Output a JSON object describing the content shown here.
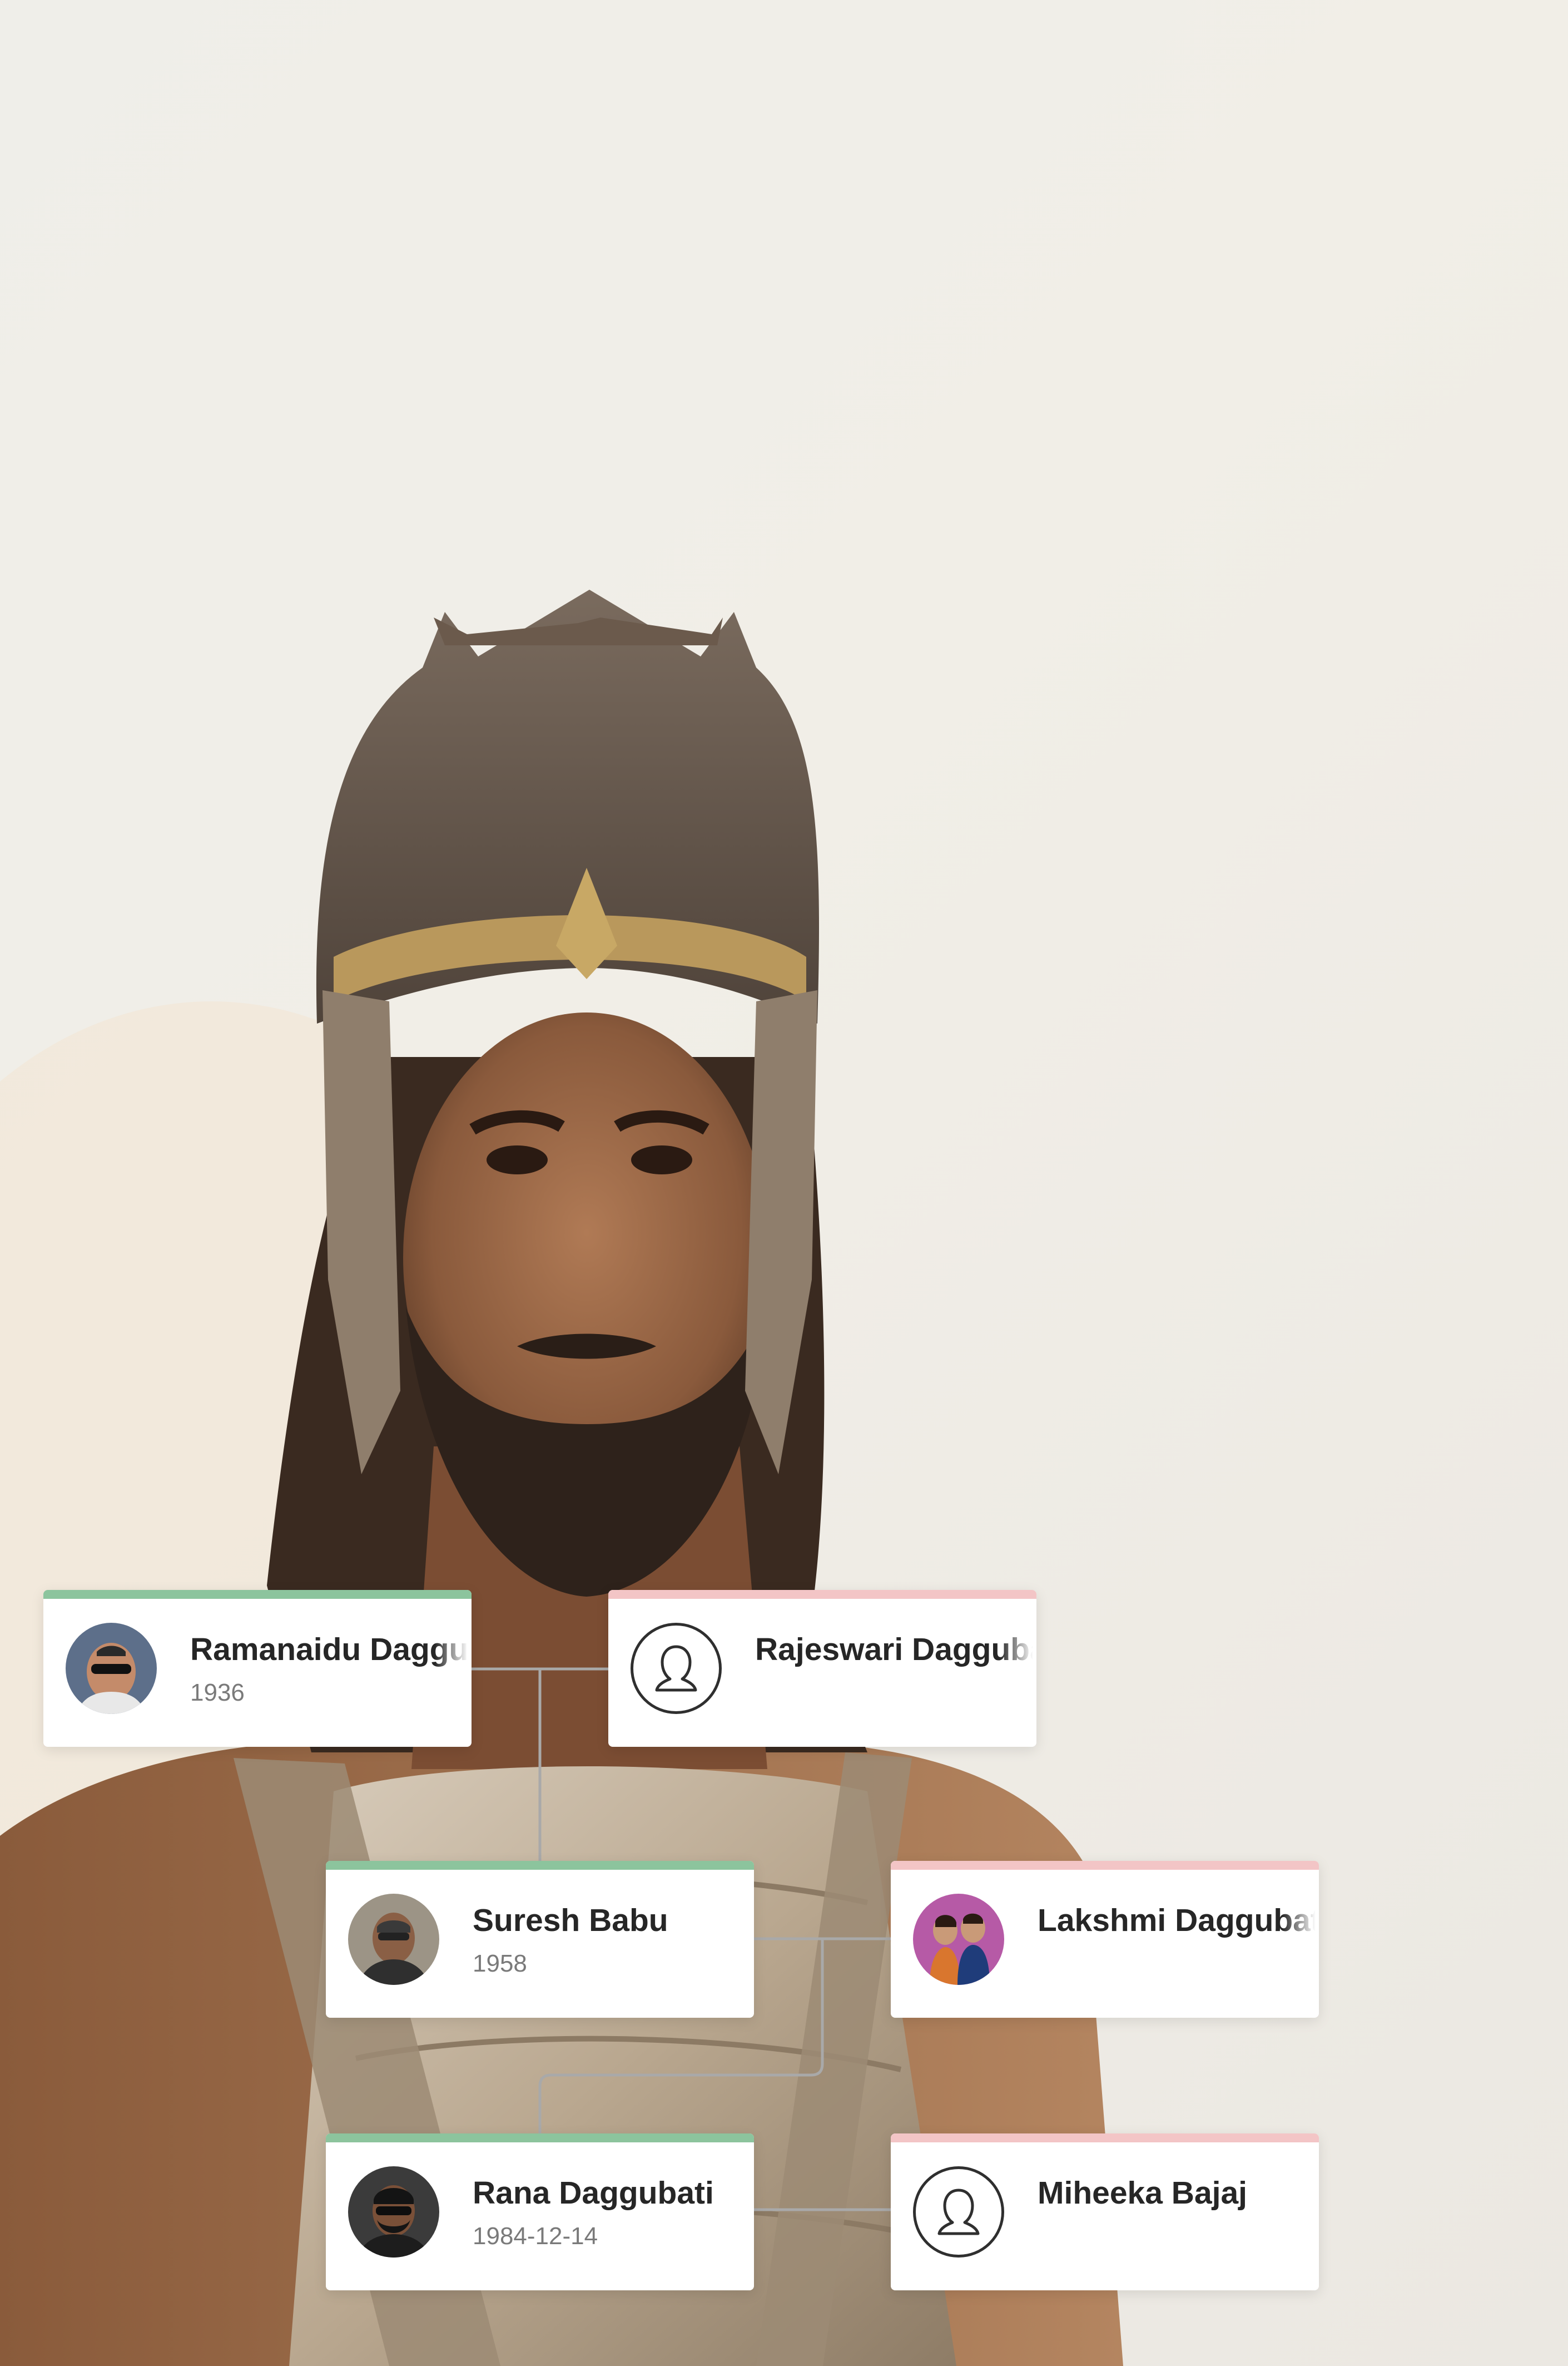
{
  "colors": {
    "male_bar": "#8cc49d",
    "female_bar": "#f3c5c6",
    "connector": "#a9a9a9",
    "card_bg": "#ffffff"
  },
  "people": [
    {
      "id": "ramanaidu",
      "name": "Ramanaidu Daggubati",
      "year": "1936",
      "gender": "male",
      "avatar": "photo"
    },
    {
      "id": "rajeswari",
      "name": "Rajeswari Daggubati",
      "year": "",
      "gender": "female",
      "avatar": "placeholder-icon"
    },
    {
      "id": "suresh",
      "name": "Suresh Babu",
      "year": "1958",
      "gender": "male",
      "avatar": "photo"
    },
    {
      "id": "lakshmi",
      "name": "Lakshmi Daggubati",
      "year": "",
      "gender": "female",
      "avatar": "photo"
    },
    {
      "id": "rana",
      "name": "Rana Daggubati",
      "year": "1984-12-14",
      "gender": "male",
      "avatar": "photo"
    },
    {
      "id": "miheeka",
      "name": "Miheeka Bajaj",
      "year": "",
      "gender": "female",
      "avatar": "placeholder-icon"
    }
  ]
}
